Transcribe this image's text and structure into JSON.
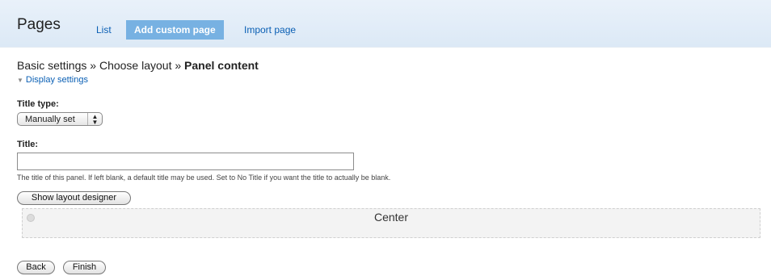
{
  "header": {
    "title": "Pages",
    "tabs": [
      {
        "label": "List"
      },
      {
        "label": "Add custom page"
      },
      {
        "label": "Import page"
      }
    ]
  },
  "breadcrumb": {
    "step1": "Basic settings",
    "sep": "»",
    "step2": "Choose layout",
    "current": "Panel content"
  },
  "display_settings": {
    "toggle_icon": "triangle-down-icon",
    "label": "Display settings"
  },
  "form": {
    "title_type_label": "Title type:",
    "title_type_value": "Manually set",
    "title_label": "Title:",
    "title_value": "",
    "title_description": "The title of this panel. If left blank, a default title may be used. Set to No Title if you want the title to actually be blank."
  },
  "layout": {
    "show_designer_label": "Show layout designer",
    "region_title": "Center"
  },
  "actions": {
    "back_label": "Back",
    "finish_label": "Finish"
  }
}
